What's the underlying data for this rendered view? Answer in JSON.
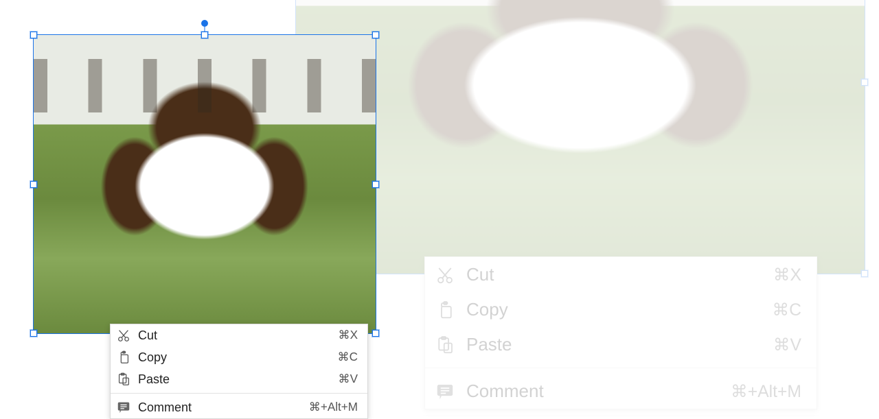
{
  "selection": {
    "handle_color": "#1a73e8"
  },
  "faded_opacity": 0.8,
  "menu": {
    "items": [
      {
        "icon": "cut-icon",
        "label": "Cut",
        "shortcut": "⌘X"
      },
      {
        "icon": "copy-icon",
        "label": "Copy",
        "shortcut": "⌘C"
      },
      {
        "icon": "paste-icon",
        "label": "Paste",
        "shortcut": "⌘V"
      }
    ],
    "separator": true,
    "comment": {
      "icon": "comment-icon",
      "label": "Comment",
      "shortcut": "⌘+Alt+M"
    }
  }
}
